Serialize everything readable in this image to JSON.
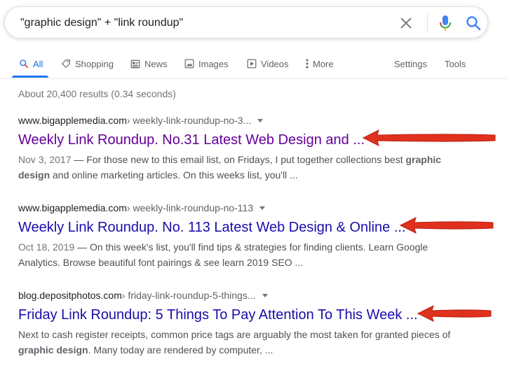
{
  "search": {
    "query": "\"graphic design\" + \"link roundup\""
  },
  "tabs": [
    {
      "label": "All"
    },
    {
      "label": "Shopping"
    },
    {
      "label": "News"
    },
    {
      "label": "Images"
    },
    {
      "label": "Videos"
    },
    {
      "label": "More"
    },
    {
      "label": "Settings"
    },
    {
      "label": "Tools"
    }
  ],
  "stats": "About 20,400 results (0.34 seconds)",
  "results": [
    {
      "domain": "www.bigapplemedia.com",
      "path": " › weekly-link-roundup-no-3...",
      "title": "Weekly Link Roundup. No.31 Latest Web Design and ...",
      "date": "Nov 3, 2017",
      "snippet_parts": [
        " — For those new to this email list, on Fridays, I put together collections best ",
        "graphic design",
        " and online marketing articles. On this weeks list, you'll ..."
      ]
    },
    {
      "domain": "www.bigapplemedia.com",
      "path": " › weekly-link-roundup-no-113",
      "title": "Weekly Link Roundup. No. 113 Latest Web Design & Online ...",
      "date": "Oct 18, 2019",
      "snippet_parts": [
        " — On this week's list, you'll find tips & strategies for finding clients. Learn Google Analytics. Browse beautiful font pairings & see learn 2019 SEO ..."
      ]
    },
    {
      "domain": "blog.depositphotos.com",
      "path": " › friday-link-roundup-5-things...",
      "title": "Friday Link Roundup: 5 Things To Pay Attention To This Week ...",
      "snippet_parts": [
        "Next to cash register receipts, common price tags are arguably the most taken for granted pieces of ",
        "graphic design",
        ". Many today are rendered by computer, ..."
      ]
    }
  ],
  "colors": {
    "accent": "#1a73e8",
    "visited_link": "#660099",
    "link": "#1a0dab",
    "annotation_arrow": "#e0301e"
  },
  "icons": [
    "clear-icon",
    "microphone-icon",
    "search-icon",
    "shopping-tag-icon",
    "news-icon",
    "images-icon",
    "videos-icon",
    "more-dots-icon",
    "caret-down-icon",
    "annotation-arrow"
  ]
}
